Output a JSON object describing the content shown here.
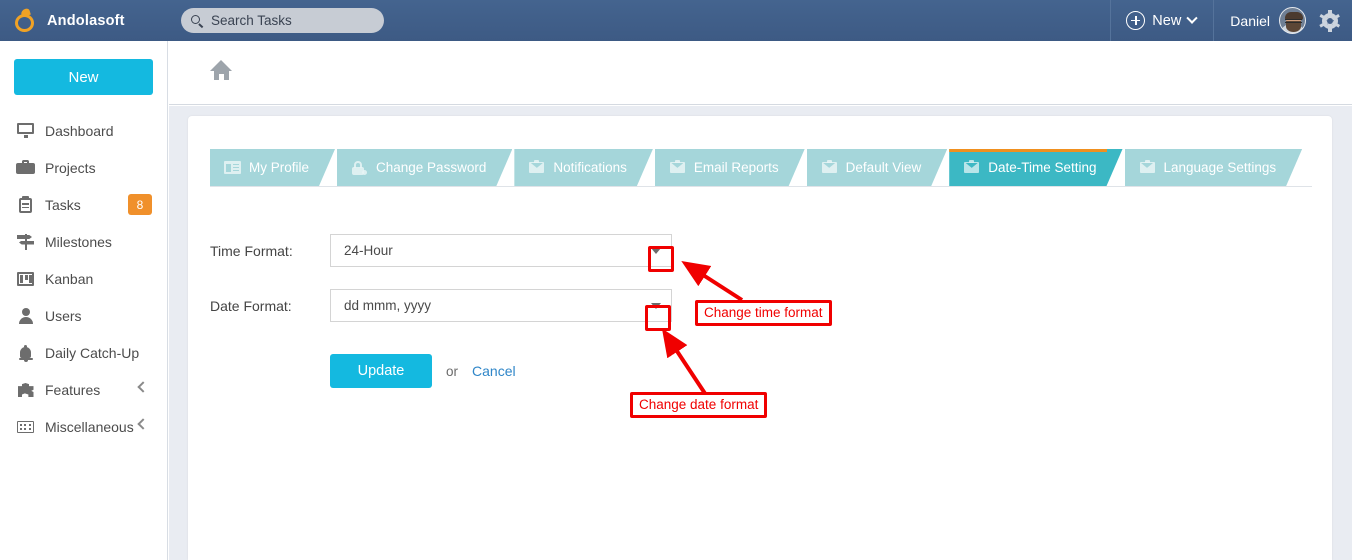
{
  "header": {
    "brand": "Andolasoft",
    "brand_logo_icon": "apple-logo-icon",
    "search": {
      "icon": "search-icon",
      "value": "",
      "placeholder": "Search Tasks"
    },
    "new_button": {
      "label": "New",
      "plus_icon": "plus-circle-icon",
      "chevron_icon": "chevron-down-icon"
    },
    "user": {
      "name": "Daniel",
      "avatar_icon": "user-avatar"
    },
    "settings_icon": "gear-icon",
    "bg_color": "#3d5a84"
  },
  "sidebar": {
    "new_button_label": "New",
    "new_button_color": "#14b9e0",
    "items": [
      {
        "label": "Dashboard",
        "icon": "monitor-icon"
      },
      {
        "label": "Projects",
        "icon": "briefcase-icon"
      },
      {
        "label": "Tasks",
        "icon": "clipboard-icon",
        "badge": "8",
        "badge_color": "#f0902b"
      },
      {
        "label": "Milestones",
        "icon": "milestone-signpost-icon"
      },
      {
        "label": "Kanban",
        "icon": "kanban-board-icon"
      },
      {
        "label": "Users",
        "icon": "user-icon"
      },
      {
        "label": "Daily Catch-Up",
        "icon": "bell-icon"
      },
      {
        "label": "Features",
        "icon": "puzzle-piece-icon",
        "expand_icon": "chevron-left-icon"
      },
      {
        "label": "Miscellaneous",
        "icon": "grid-icon",
        "expand_icon": "chevron-left-icon"
      }
    ]
  },
  "breadcrumb": {
    "home_icon": "home-icon"
  },
  "tabs": [
    {
      "label": "My Profile",
      "icon": "contact-card-icon",
      "active": false
    },
    {
      "label": "Change Password",
      "icon": "lock-icon",
      "active": false
    },
    {
      "label": "Notifications",
      "icon": "envelope-bell-icon",
      "active": false
    },
    {
      "label": "Email Reports",
      "icon": "envelope-icon",
      "active": false
    },
    {
      "label": "Default View",
      "icon": "envelope-icon",
      "active": false
    },
    {
      "label": "Date-Time Setting",
      "icon": "envelope-icon",
      "active": true
    },
    {
      "label": "Language Settings",
      "icon": "envelope-icon",
      "active": false
    }
  ],
  "tab_colors": {
    "inactive": "#a5d6da",
    "active": "#3cb8c4",
    "active_top_bar": "#f0901f"
  },
  "form": {
    "time_format": {
      "label": "Time Format:",
      "value": "24-Hour",
      "arrow_icon": "dropdown-arrow-icon"
    },
    "date_format": {
      "label": "Date Format:",
      "value": "dd mmm, yyyy",
      "arrow_icon": "dropdown-arrow-icon"
    },
    "update_label": "Update",
    "or_label": "or",
    "cancel_label": "Cancel"
  },
  "annotations": {
    "color": "#f00000",
    "callouts": [
      {
        "text": "Change time format"
      },
      {
        "text": "Change date format"
      }
    ]
  }
}
